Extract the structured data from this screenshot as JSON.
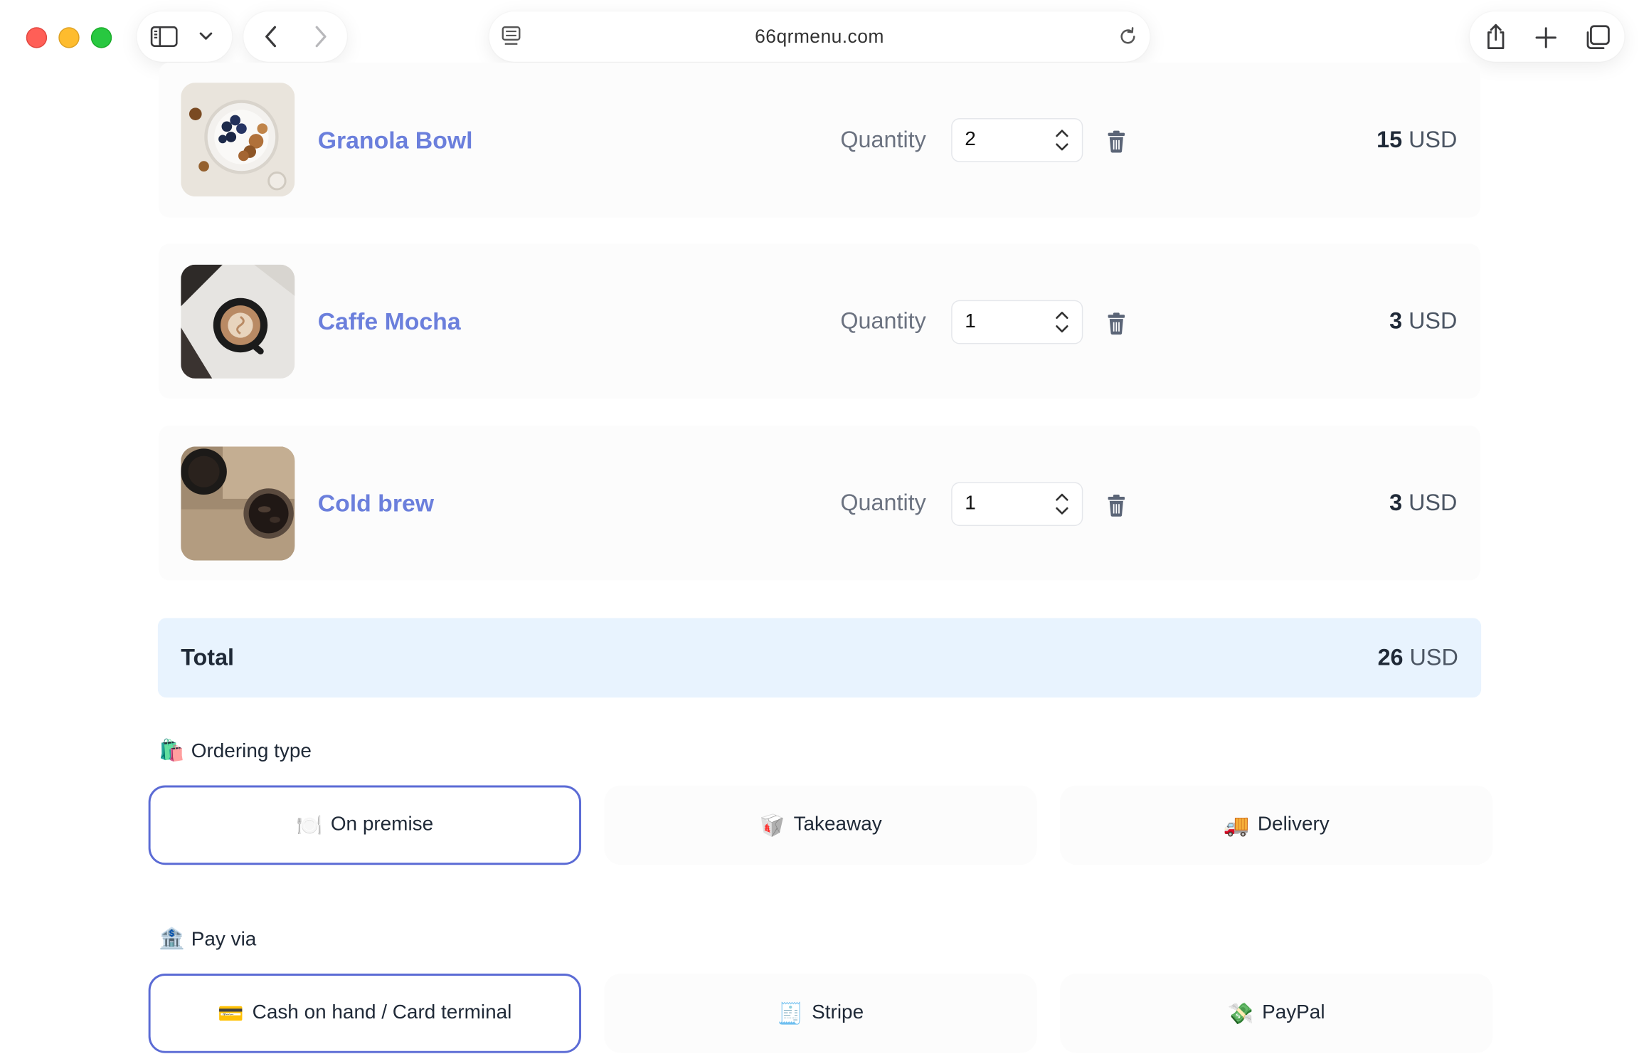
{
  "browser": {
    "url": "66qrmenu.com"
  },
  "cart": {
    "quantity_label": "Quantity",
    "items": [
      {
        "name": "Granola Bowl",
        "quantity": "2",
        "price_amount": "15",
        "currency": "USD"
      },
      {
        "name": "Caffe Mocha",
        "quantity": "1",
        "price_amount": "3",
        "currency": "USD"
      },
      {
        "name": "Cold brew",
        "quantity": "1",
        "price_amount": "3",
        "currency": "USD"
      }
    ],
    "total_label": "Total",
    "total_amount": "26",
    "total_currency": "USD"
  },
  "ordering": {
    "title_emoji": "🛍️",
    "title": "Ordering type",
    "options": [
      {
        "emoji": "🍽️",
        "label": "On premise",
        "selected": true
      },
      {
        "emoji": "🥡",
        "label": "Takeaway",
        "selected": false
      },
      {
        "emoji": "🚚",
        "label": "Delivery",
        "selected": false
      }
    ]
  },
  "payment": {
    "title_emoji": "🏦",
    "title": "Pay via",
    "options": [
      {
        "emoji": "💳",
        "label": "Cash on hand / Card terminal",
        "selected": true
      },
      {
        "emoji": "🧾",
        "label": "Stripe",
        "selected": false
      },
      {
        "emoji": "💸",
        "label": "PayPal",
        "selected": false
      }
    ]
  },
  "colors": {
    "accent": "#5b6bd5",
    "item_name": "#6b7fdc",
    "total_bg": "#e8f3fe"
  }
}
